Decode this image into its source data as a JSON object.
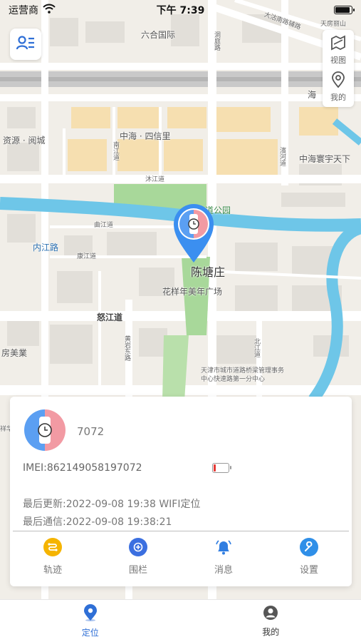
{
  "status_bar": {
    "carrier": "运营商",
    "time": "下午 7:39"
  },
  "map": {
    "labels": {
      "liuhe": "六合国际",
      "zhonghai_sixin": "中海 · 四信里",
      "ziyuan_yuecheng": "资源 · 阅城",
      "zhonghai_huanyu": "中海寰宇天下",
      "neijiang_road": "内江路",
      "chentangzhuang": "陈塘庄",
      "huayang_plaza": "花样年美年广场",
      "nujiang_road": "怒江道",
      "fang_meiye": "房美業",
      "tianjin_bridge": "天津市城市道路桥梁管理事务中心快速路第一分中心",
      "tianfang": "天房丽山",
      "dongting_road": "洞庭路",
      "park": "道公园",
      "qujiang_road": "曲江道",
      "kangjiang_road": "康江道",
      "mujiang_road": "沐江道",
      "nanjiang_road": "南江道",
      "bingjiang_road": "濱河道",
      "huangbai_east": "黄岩东路",
      "beijiang_road": "北江道",
      "yuxiang": "祥华",
      "hai": "海",
      "dagu_south": "大沽南路辅路"
    }
  },
  "controls": {
    "view_label": "视图",
    "mine_label": "我的"
  },
  "device": {
    "name": "7072",
    "imei": "IMEI:862149058197072",
    "battery_level": 0.15,
    "last_update": "最后更新:2022-09-08 19:38 WIFI定位",
    "last_comm": "最后通信:2022-09-08 19:38:21"
  },
  "actions": [
    {
      "label": "轨迹",
      "icon": "track-icon",
      "color": "#f5b400"
    },
    {
      "label": "围栏",
      "icon": "fence-icon",
      "color": "#3b6fe0"
    },
    {
      "label": "消息",
      "icon": "bell-icon",
      "color": "#2f7de1"
    },
    {
      "label": "设置",
      "icon": "wrench-icon",
      "color": "#2f8fe8"
    }
  ],
  "tabs": [
    {
      "label": "定位",
      "icon": "location-icon",
      "active": true
    },
    {
      "label": "我的",
      "icon": "profile-icon",
      "active": false
    }
  ],
  "colors": {
    "accent": "#2f6fd6",
    "marker": "#3b8ff0",
    "river": "#6ec6e8",
    "park": "#a8d89a",
    "block": "#f6dfb0"
  }
}
